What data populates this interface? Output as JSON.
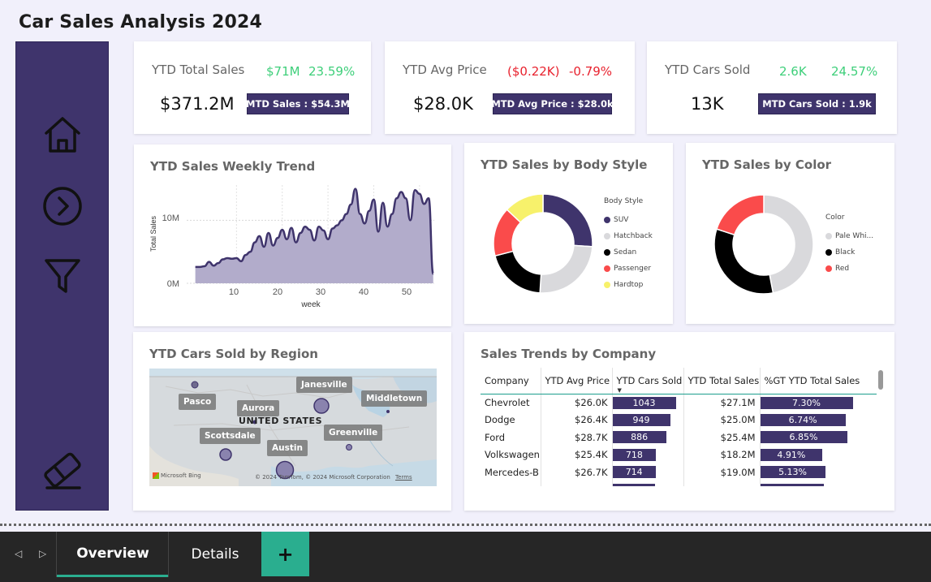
{
  "page": {
    "title": "Car Sales Analysis 2024"
  },
  "sidebar": {
    "icons": [
      "home-icon",
      "next-circle-icon",
      "filter-icon",
      "eraser-icon"
    ]
  },
  "kpis": [
    {
      "label": "YTD Total Sales",
      "delta_value": "$71M",
      "delta_pct": "23.59%",
      "delta_color": "#3ecf7a",
      "value": "$371.2M",
      "mtd": "MTD Sales : $54.3M"
    },
    {
      "label": "YTD Avg Price",
      "delta_value": "($0.22K)",
      "delta_pct": "-0.79%",
      "delta_color": "#e8222e",
      "value": "$28.0K",
      "mtd": "MTD Avg Price : $28.0k"
    },
    {
      "label": "YTD Cars Sold",
      "delta_value": "2.6K",
      "delta_pct": "24.57%",
      "delta_color": "#3ecf7a",
      "value": "13K",
      "mtd": "MTD Cars Sold : 1.9k"
    }
  ],
  "weekly_trend": {
    "title": "YTD Sales Weekly Trend",
    "ylabel": "Total Sales",
    "xlabel": "week",
    "ytick_labels": [
      "10M",
      "0M"
    ],
    "xtick_labels": [
      "10",
      "20",
      "30",
      "40",
      "50"
    ]
  },
  "body_style": {
    "title": "YTD Sales by Body Style",
    "legend_title": "Body Style",
    "legend": [
      "SUV",
      "Hatchback",
      "Sedan",
      "Passenger",
      "Hardtop"
    ]
  },
  "color_chart": {
    "title": "YTD Sales by Color",
    "legend_title": "Color",
    "legend": [
      "Pale Whi...",
      "Black",
      "Red"
    ]
  },
  "region": {
    "title": "YTD Cars Sold by Region",
    "labels": [
      "Janesville",
      "Pasco",
      "Aurora",
      "Middletown",
      "UNITED STATES",
      "Scottsdale",
      "Greenville",
      "Austin"
    ],
    "attribution": "© 2024 TomTom, © 2024 Microsoft Corporation",
    "terms": "Terms",
    "brand": "Microsoft Bing"
  },
  "company_table": {
    "title": "Sales Trends by Company",
    "columns": [
      "Company",
      "YTD Avg Price",
      "YTD Cars Sold",
      "YTD Total Sales",
      "%GT YTD Total Sales"
    ],
    "rows": [
      {
        "company": "Chevrolet",
        "avg_price": "$26.0K",
        "cars_sold": "1043",
        "total_sales": "$27.1M",
        "pct": "7.30%"
      },
      {
        "company": "Dodge",
        "avg_price": "$26.4K",
        "cars_sold": "949",
        "total_sales": "$25.0M",
        "pct": "6.74%"
      },
      {
        "company": "Ford",
        "avg_price": "$28.7K",
        "cars_sold": "886",
        "total_sales": "$25.4M",
        "pct": "6.85%"
      },
      {
        "company": "Volkswagen",
        "avg_price": "$25.4K",
        "cars_sold": "718",
        "total_sales": "$18.2M",
        "pct": "4.91%"
      },
      {
        "company": "Mercedes-B",
        "avg_price": "$26.7K",
        "cars_sold": "714",
        "total_sales": "$19.0M",
        "pct": "5.13%"
      }
    ],
    "cars_sold_max": 1043,
    "pct_max": 7.3
  },
  "tabs": {
    "items": [
      "Overview",
      "Details"
    ],
    "active": "Overview",
    "add": "+"
  },
  "colors": {
    "primary": "#3f346c",
    "accent": "#2aae8f",
    "positive": "#3ecf7a",
    "negative": "#e8222e",
    "area": "#b2accb"
  },
  "chart_data": [
    {
      "type": "area",
      "title": "YTD Sales Weekly Trend",
      "xlabel": "week",
      "ylabel": "Total Sales",
      "x": [
        1,
        2,
        3,
        4,
        5,
        6,
        7,
        8,
        9,
        10,
        11,
        12,
        13,
        14,
        15,
        16,
        17,
        18,
        19,
        20,
        21,
        22,
        23,
        24,
        25,
        26,
        27,
        28,
        29,
        30,
        31,
        32,
        33,
        34,
        35,
        36,
        37,
        38,
        39,
        40,
        41,
        42,
        43,
        44,
        45,
        46,
        47,
        48,
        49,
        50,
        51,
        52,
        53
      ],
      "values": [
        2.6,
        2.6,
        2.7,
        3.4,
        2.8,
        3.2,
        3.8,
        4.0,
        3.9,
        4.0,
        3.5,
        4.5,
        5.0,
        6.5,
        7.5,
        5.8,
        8.0,
        6.0,
        7.2,
        8.5,
        7.0,
        8.8,
        6.5,
        8.0,
        9.0,
        8.5,
        6.8,
        9.0,
        8.4,
        7.0,
        8.7,
        9.2,
        10.0,
        11.0,
        12.5,
        15.0,
        11.0,
        9.5,
        11.5,
        13.3,
        8.2,
        12.8,
        9.0,
        11.0,
        13.5,
        14.5,
        13.5,
        10.0,
        14.8,
        14.2,
        12.6,
        13.5,
        1.5
      ],
      "ylim": [
        0,
        15.6
      ],
      "xlim": [
        0,
        55
      ],
      "unit": "M",
      "grid": true
    },
    {
      "type": "pie",
      "title": "YTD Sales by Body Style",
      "categories": [
        "SUV",
        "Hatchback",
        "Sedan",
        "Passenger",
        "Hardtop"
      ],
      "values": [
        26,
        25,
        20,
        16,
        13
      ],
      "colors": [
        "#3f346c",
        "#d9d9dc",
        "#000000",
        "#fa4b4b",
        "#f7f16b"
      ]
    },
    {
      "type": "pie",
      "title": "YTD Sales by Color",
      "categories": [
        "Pale Whi...",
        "Black",
        "Red"
      ],
      "values": [
        47,
        33,
        20
      ],
      "colors": [
        "#d9d9dc",
        "#000000",
        "#fa4b4b"
      ]
    }
  ]
}
